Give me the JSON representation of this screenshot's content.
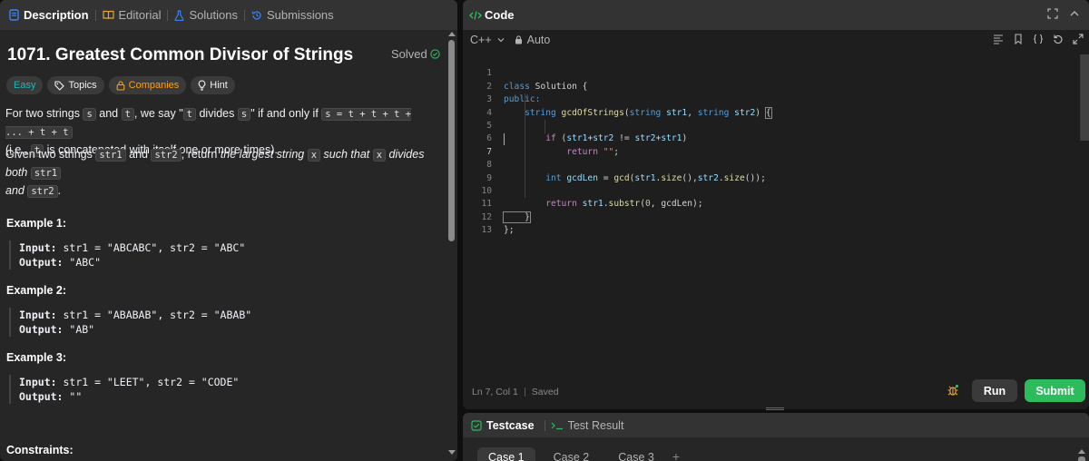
{
  "left_tabs": [
    {
      "label": "Description",
      "icon": "description-icon"
    },
    {
      "label": "Editorial",
      "icon": "book-icon"
    },
    {
      "label": "Solutions",
      "icon": "flask-icon"
    },
    {
      "label": "Submissions",
      "icon": "history-icon"
    }
  ],
  "problem": {
    "title": "1071. Greatest Common Divisor of Strings",
    "status": "Solved",
    "tags": {
      "difficulty": "Easy",
      "topics": "Topics",
      "companies": "Companies",
      "hint": "Hint"
    },
    "desc1": {
      "a": "For two strings ",
      "s1": "s",
      "b": " and ",
      "t1": "t",
      "c": ", we say \"",
      "t2": "t",
      "d": " divides ",
      "s2": "s",
      "e": "\" if and only if ",
      "expr": "s = t + t + t + ... + t + t",
      "f": "(i.e., ",
      "t3": "t",
      "g": " is concatenated with itself one or more times)."
    },
    "desc2": {
      "a": "Given two strings ",
      "str1": "str1",
      "b": " and ",
      "str2": "str2",
      "c": ", return ",
      "d": "the largest string ",
      "x1": "x",
      "e": " such that ",
      "x2": "x",
      "f": " divides both ",
      "str1b": "str1",
      "g": "and ",
      "str2b": "str2",
      "h": "."
    },
    "examples": [
      {
        "title": "Example 1:",
        "input_label": "Input:",
        "input": " str1 = \"ABCABC\", str2 = \"ABC\"",
        "output_label": "Output:",
        "output": " \"ABC\""
      },
      {
        "title": "Example 2:",
        "input_label": "Input:",
        "input": " str1 = \"ABABAB\", str2 = \"ABAB\"",
        "output_label": "Output:",
        "output": " \"AB\""
      },
      {
        "title": "Example 3:",
        "input_label": "Input:",
        "input": " str1 = \"LEET\", str2 = \"CODE\"",
        "output_label": "Output:",
        "output": " \"\""
      }
    ],
    "constraints_title": "Constraints:"
  },
  "code_panel": {
    "title": "Code",
    "language": "C++",
    "mode": "Auto",
    "line_numbers": [
      "1",
      "2",
      "3",
      "4",
      "5",
      "6",
      "7",
      "8",
      "9",
      "10",
      "11",
      "12",
      "13"
    ],
    "code": {
      "l1a": "class",
      "l1b": " Solution {",
      "l2": "public:",
      "l3a": "    string",
      "l3b": " gcdOfStrings",
      "l3c": "(",
      "l3d": "string",
      "l3e": " str1",
      "l3f": ", ",
      "l3g": "string",
      "l3h": " str2",
      "l3i": ") ",
      "l3j": "{",
      "l5a": "        if",
      "l5b": " (",
      "l5c": "str1",
      "l5d": "+",
      "l5e": "str2",
      "l5f": " != ",
      "l5g": "str2",
      "l5h": "+",
      "l5i": "str1",
      "l5j": ")",
      "l6a": "            return",
      "l6b": " \"\"",
      "l6c": ";",
      "l8a": "        int",
      "l8b": " gcdLen",
      "l8c": " = ",
      "l8d": "gcd",
      "l8e": "(",
      "l8f": "str1",
      "l8g": ".",
      "l8h": "size",
      "l8i": "(),",
      "l8j": "str2",
      "l8k": ".",
      "l8l": "size",
      "l8m": "());",
      "l10a": "        return",
      "l10b": " str1",
      "l10c": ".",
      "l10d": "substr",
      "l10e": "(",
      "l10f": "0",
      "l10g": ", gcdLen);",
      "l11": "    }",
      "l12": "};"
    },
    "status_position": "Ln 7, Col 1",
    "status_saved": "Saved",
    "run_label": "Run",
    "submit_label": "Submit"
  },
  "test_panel": {
    "testcase_label": "Testcase",
    "result_label": "Test Result",
    "cases": [
      "Case 1",
      "Case 2",
      "Case 3"
    ],
    "add_label": "+"
  },
  "colors": {
    "accent_green": "#2cbb5d",
    "easy": "#1cbaba",
    "companies": "#ffa116",
    "solved_check": "#2cbb5d"
  }
}
